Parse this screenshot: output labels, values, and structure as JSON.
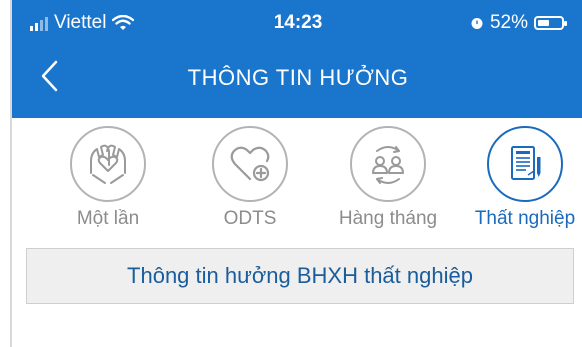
{
  "status_bar": {
    "carrier": "Viettel",
    "time": "14:23",
    "battery_percent": "52%",
    "battery_level": 0.52
  },
  "nav": {
    "title": "THÔNG TIN HƯỞNG",
    "back_icon": "chevron-left-icon"
  },
  "tabs": [
    {
      "label": "Một lần",
      "icon": "hands-heart-icon",
      "active": false
    },
    {
      "label": "ODTS",
      "icon": "heart-plus-icon",
      "active": false
    },
    {
      "label": "Hàng tháng",
      "icon": "people-cycle-icon",
      "active": false
    },
    {
      "label": "Thất nghiệp",
      "icon": "document-pen-icon",
      "active": true
    }
  ],
  "info_box": {
    "text": "Thông tin hưởng BHXH thất nghiệp"
  },
  "colors": {
    "header_blue": "#1a76cc",
    "active_blue": "#1a6bbd",
    "inactive_gray": "#8c8c8c",
    "info_text": "#1a5d9c",
    "info_bg": "#efefef"
  }
}
